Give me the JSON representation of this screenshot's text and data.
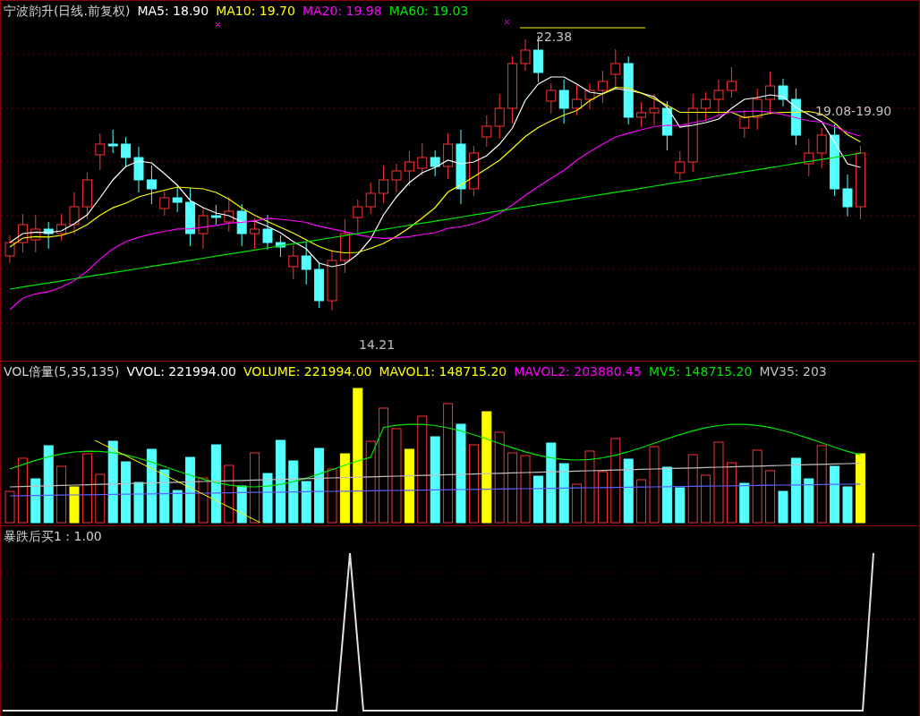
{
  "main_panel": {
    "title": "宁波韵升(日线.前复权)",
    "indicators": [
      {
        "label": "MA5: 18.90",
        "color": "#ffffff"
      },
      {
        "label": "MA10: 19.70",
        "color": "#ffff00"
      },
      {
        "label": "MA20: 19.98",
        "color": "#ff00ff"
      },
      {
        "label": "MA60: 19.03",
        "color": "#00e600"
      }
    ],
    "annotations": [
      {
        "text": "22.38"
      },
      {
        "text": "14.21"
      },
      {
        "text": "19.08-19.90"
      }
    ]
  },
  "volume_panel": {
    "title": "VOL倍量(5,35,135)",
    "indicators": [
      {
        "label": "VVOL: 221994.00",
        "color": "#ffffff"
      },
      {
        "label": "VOLUME: 221994.00",
        "color": "#ffff00"
      },
      {
        "label": "MAVOL1: 148715.20",
        "color": "#ffff00"
      },
      {
        "label": "MAVOL2: 203880.45",
        "color": "#ff00ff"
      },
      {
        "label": "MV5: 148715.20",
        "color": "#00e600"
      },
      {
        "label": "MV35: 203",
        "color": "#c0c0c0"
      }
    ]
  },
  "signal_panel": {
    "title": "暴跌后买1 : 1.00"
  }
}
